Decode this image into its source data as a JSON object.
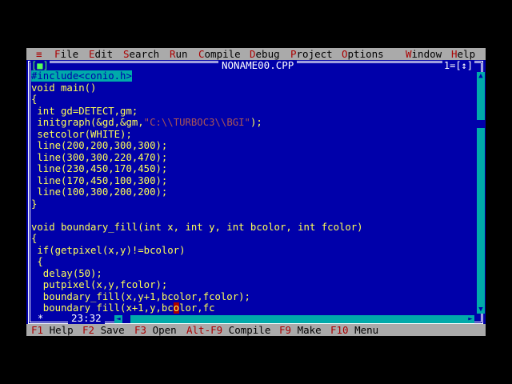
{
  "menu": {
    "system": "≡",
    "items": [
      {
        "hotkey": "F",
        "rest": "ile"
      },
      {
        "hotkey": "E",
        "rest": "dit"
      },
      {
        "hotkey": "S",
        "rest": "earch"
      },
      {
        "hotkey": "R",
        "rest": "un"
      },
      {
        "hotkey": "C",
        "rest": "ompile"
      },
      {
        "hotkey": "D",
        "rest": "ebug"
      },
      {
        "hotkey": "P",
        "rest": "roject"
      },
      {
        "hotkey": "O",
        "rest": "ptions"
      },
      {
        "hotkey": "W",
        "rest": "indow"
      },
      {
        "hotkey": "H",
        "rest": "elp"
      }
    ]
  },
  "window": {
    "close_box": "[■]",
    "title": "NONAME00.CPP",
    "number": "1=[↕]"
  },
  "code": {
    "lines": [
      {
        "pre": "",
        "hl": "#include<conio.h>",
        "post": ""
      },
      {
        "pre": "void main()",
        "hl": "",
        "post": ""
      },
      {
        "pre": "{",
        "hl": "",
        "post": ""
      },
      {
        "pre": " int gd=DETECT,gm;",
        "hl": "",
        "post": ""
      },
      {
        "pre": " initgraph(&gd,&gm,",
        "str": "\"C:\\\\TURBOC3\\\\BGI\"",
        "post": ");"
      },
      {
        "pre": " setcolor(WHITE);",
        "hl": "",
        "post": ""
      },
      {
        "pre": " line(200,200,300,300);",
        "hl": "",
        "post": ""
      },
      {
        "pre": " line(300,300,220,470);",
        "hl": "",
        "post": ""
      },
      {
        "pre": " line(230,450,170,450);",
        "hl": "",
        "post": ""
      },
      {
        "pre": " line(170,450,100,300);",
        "hl": "",
        "post": ""
      },
      {
        "pre": " line(100,300,200,200);",
        "hl": "",
        "post": ""
      },
      {
        "pre": "}",
        "hl": "",
        "post": ""
      },
      {
        "pre": "",
        "hl": "",
        "post": ""
      },
      {
        "pre": "void boundary_fill(int x, int y, int bcolor, int fcolor)",
        "hl": "",
        "post": ""
      },
      {
        "pre": "{",
        "hl": "",
        "post": ""
      },
      {
        "pre": " if(getpixel(x,y)!=bcolor)",
        "hl": "",
        "post": ""
      },
      {
        "pre": " {",
        "hl": "",
        "post": ""
      },
      {
        "pre": "  delay(50);",
        "hl": "",
        "post": ""
      },
      {
        "pre": "  putpixel(x,y,fcolor);",
        "hl": "",
        "post": ""
      },
      {
        "pre": "  boundary_fill(x,y+1,bcolor,fcolor);",
        "hl": "",
        "post": ""
      },
      {
        "pre": "  boundary_fill(x+1,y,bc",
        "cursor": "o",
        "post": "lor,fc"
      }
    ]
  },
  "status": {
    "modified": "*",
    "position": "23:32"
  },
  "fkeys": [
    {
      "key": "F1",
      "label": " Help"
    },
    {
      "key": "F2",
      "label": " Save"
    },
    {
      "key": "F3",
      "label": " Open"
    },
    {
      "key": "Alt-F9",
      "label": " Compile"
    },
    {
      "key": "F9",
      "label": " Make"
    },
    {
      "key": "F10",
      "label": " Menu"
    }
  ],
  "colors": {
    "editor_bg": "#0000AA",
    "menu_bg": "#AAAAAA",
    "hotkey": "#AA0000",
    "code_text": "#FFFF55",
    "string": "#AA5555",
    "scrollbar": "#00AAAA"
  }
}
